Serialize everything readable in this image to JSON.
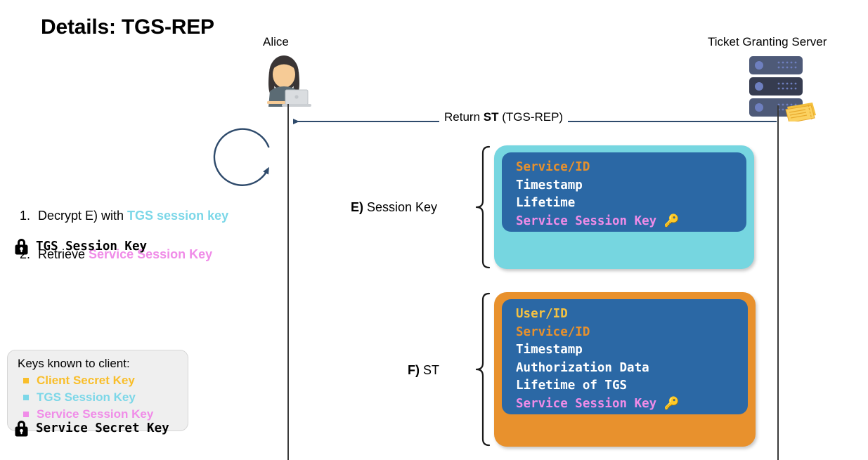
{
  "slide": {
    "title": "Details: TGS-REP"
  },
  "actors": {
    "client": {
      "label": "Alice",
      "icon": "person-with-laptop-avatar"
    },
    "server": {
      "label": "Ticket Granting Server",
      "icon": "server-stack-with-ticket-icon"
    }
  },
  "message": {
    "label_prefix": "Return ",
    "label_bold": "ST",
    "label_suffix": " (TGS-REP)",
    "direction": "server-to-client",
    "arrow_color": "#2E4A6B"
  },
  "self_loop": {
    "icon": "circular-arrow-icon",
    "color": "#2E4A6B"
  },
  "steps": [
    {
      "number": "1.",
      "text_before": "Decrypt E) with ",
      "highlight": "TGS session key",
      "highlight_color": "#7CD7E8",
      "text_after": ""
    },
    {
      "number": "2.",
      "text_before": "Retrieve ",
      "highlight": "Service Session Key",
      "highlight_color": "#F08CE8",
      "text_after": ""
    }
  ],
  "legend": {
    "title": "Keys known to client:",
    "items": [
      {
        "label": "Client Secret Key",
        "color": "#F9BE2A"
      },
      {
        "label": "TGS Session Key",
        "color": "#7CD7E8"
      },
      {
        "label": "Service Session Key",
        "color": "#F08CE8"
      }
    ]
  },
  "tickets": [
    {
      "id": "E",
      "section_letter": "E)",
      "section_name": " Session Key",
      "outer_color": "#76D6E0",
      "inner_color": "#2B68A5",
      "lines": [
        {
          "text": "Service/ID",
          "color": "orange",
          "key_icon": false
        },
        {
          "text": "Timestamp",
          "color": "white",
          "key_icon": false
        },
        {
          "text": "Lifetime",
          "color": "white",
          "key_icon": false
        },
        {
          "text": "Service Session Key",
          "color": "pink",
          "key_icon": true
        }
      ],
      "footer": {
        "icon": "lock-icon",
        "text": "TGS Session Key"
      }
    },
    {
      "id": "F",
      "section_letter": "F)",
      "section_name": " ST",
      "outer_color": "#E8912D",
      "inner_color": "#2B68A5",
      "lines": [
        {
          "text": "User/ID",
          "color": "gold",
          "key_icon": false
        },
        {
          "text": "Service/ID",
          "color": "orange",
          "key_icon": false
        },
        {
          "text": "Timestamp",
          "color": "white",
          "key_icon": false
        },
        {
          "text": "Authorization Data",
          "color": "white",
          "key_icon": false
        },
        {
          "text": "Lifetime of TGS",
          "color": "white",
          "key_icon": false
        },
        {
          "text": "Service Session Key",
          "color": "pink",
          "key_icon": true
        }
      ],
      "footer": {
        "icon": "lock-icon",
        "text": "Service Secret Key"
      }
    }
  ],
  "glyphs": {
    "key": "🔑"
  }
}
